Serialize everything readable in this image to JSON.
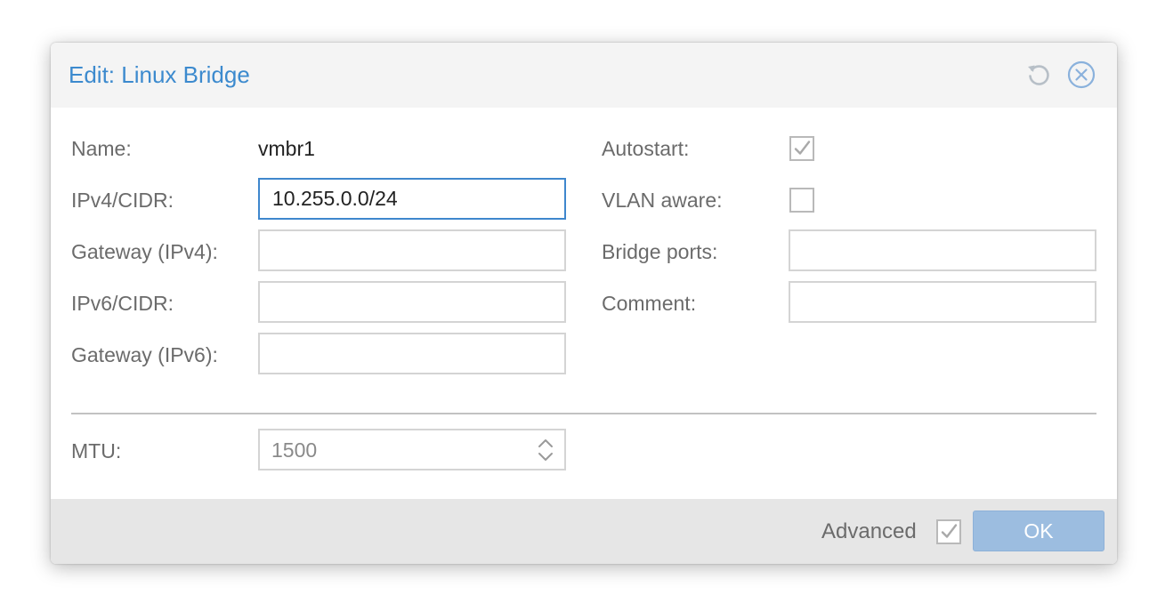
{
  "dialog": {
    "title": "Edit: Linux Bridge",
    "tools": {
      "reset_icon": "reset-icon",
      "close_icon": "close-circle-icon"
    }
  },
  "form": {
    "name": {
      "label": "Name:",
      "value": "vmbr1"
    },
    "ipv4_cidr": {
      "label": "IPv4/CIDR:",
      "value": "10.255.0.0/24"
    },
    "gateway_ipv4": {
      "label": "Gateway (IPv4):",
      "value": ""
    },
    "ipv6_cidr": {
      "label": "IPv6/CIDR:",
      "value": ""
    },
    "gateway_ipv6": {
      "label": "Gateway (IPv6):",
      "value": ""
    },
    "autostart": {
      "label": "Autostart:",
      "checked": true
    },
    "vlan_aware": {
      "label": "VLAN aware:",
      "checked": false
    },
    "bridge_ports": {
      "label": "Bridge ports:",
      "value": ""
    },
    "comment": {
      "label": "Comment:",
      "value": ""
    },
    "mtu": {
      "label": "MTU:",
      "value": "1500"
    }
  },
  "footer": {
    "advanced": {
      "label": "Advanced",
      "checked": true
    },
    "ok_label": "OK"
  },
  "colors": {
    "title": "#3c8ace",
    "focus_border": "#3f87cd",
    "ok_button": "#9cbde0",
    "footer_bg": "#e6e6e6",
    "header_bg": "#f4f4f4"
  }
}
